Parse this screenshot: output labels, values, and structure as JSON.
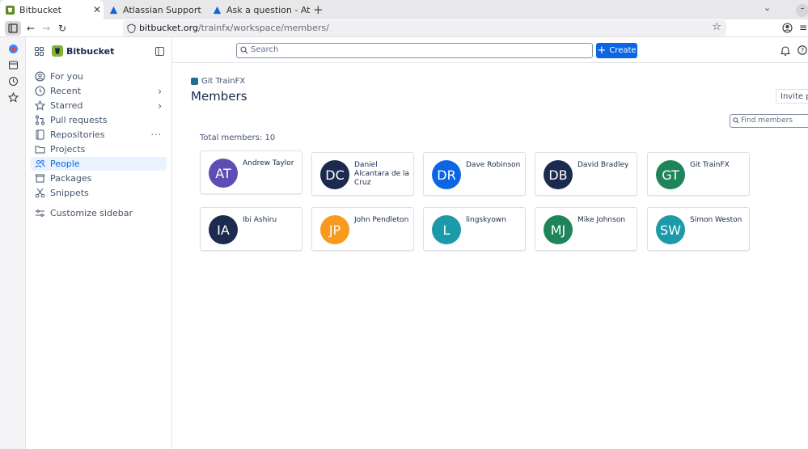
{
  "browser": {
    "tabs": [
      {
        "title": "Bitbucket",
        "active": true
      },
      {
        "title": "Atlassian Support",
        "active": false
      },
      {
        "title": "Ask a question - Atlassian",
        "active": false
      }
    ],
    "url_host": "bitbucket.org",
    "url_path": "/trainfx/workspace/members/"
  },
  "sidebar": {
    "product": "Bitbucket",
    "items": [
      {
        "label": "For you",
        "icon": "for-you-icon"
      },
      {
        "label": "Recent",
        "icon": "clock-icon",
        "chevron": true
      },
      {
        "label": "Starred",
        "icon": "star-icon",
        "chevron": true
      },
      {
        "label": "Pull requests",
        "icon": "pull-request-icon"
      },
      {
        "label": "Repositories",
        "icon": "repository-icon",
        "more": true
      },
      {
        "label": "Projects",
        "icon": "folder-icon"
      },
      {
        "label": "People",
        "icon": "people-icon",
        "selected": true
      },
      {
        "label": "Packages",
        "icon": "package-icon"
      },
      {
        "label": "Snippets",
        "icon": "scissors-icon"
      }
    ],
    "customize": "Customize sidebar"
  },
  "topbar": {
    "search_placeholder": "Search",
    "create_label": "Create"
  },
  "main": {
    "breadcrumb": "Git TrainFX",
    "title": "Members",
    "invite_label": "Invite people",
    "find_placeholder": "Find members",
    "total_label": "Total members: 10",
    "members": [
      {
        "initials": "AT",
        "name": "Andrew Taylor",
        "color": "#5e4db2"
      },
      {
        "initials": "DC",
        "name": "Daniel Alcantara de la Cruz",
        "color": "#1b2a4e"
      },
      {
        "initials": "DR",
        "name": "Dave Robinson",
        "color": "#0c66e4"
      },
      {
        "initials": "DB",
        "name": "David Bradley",
        "color": "#1b2a4e"
      },
      {
        "initials": "GT",
        "name": "Git TrainFX",
        "color": "#1f845a"
      },
      {
        "initials": "IA",
        "name": "Ibi Ashiru",
        "color": "#1b2a4e"
      },
      {
        "initials": "JP",
        "name": "John Pendleton",
        "color": "#f79a1d"
      },
      {
        "initials": "L",
        "name": "lingskyown",
        "color": "#1d9aaa"
      },
      {
        "initials": "MJ",
        "name": "Mike Johnson",
        "color": "#1f845a"
      },
      {
        "initials": "SW",
        "name": "Simon Weston",
        "color": "#1d9aaa"
      }
    ]
  }
}
